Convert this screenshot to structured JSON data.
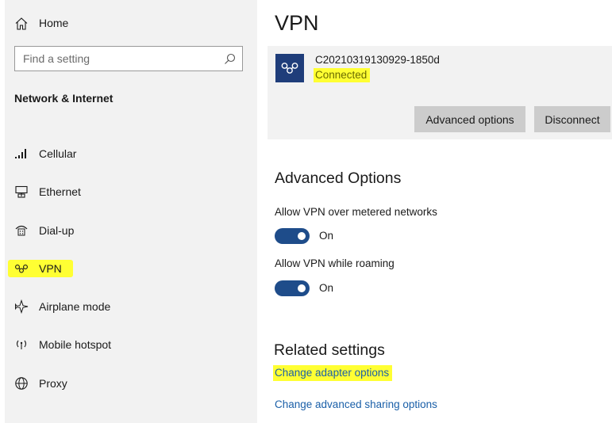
{
  "sidebar": {
    "home_label": "Home",
    "search_placeholder": "Find a setting",
    "section_title": "Network & Internet",
    "items": [
      {
        "label": "Cellular",
        "icon": "cellular-signal-icon"
      },
      {
        "label": "Ethernet",
        "icon": "ethernet-icon"
      },
      {
        "label": "Dial-up",
        "icon": "dialup-icon"
      },
      {
        "label": "VPN",
        "icon": "vpn-icon",
        "selected": true
      },
      {
        "label": "Airplane mode",
        "icon": "airplane-icon"
      },
      {
        "label": "Mobile hotspot",
        "icon": "hotspot-icon"
      },
      {
        "label": "Proxy",
        "icon": "globe-icon"
      }
    ]
  },
  "main": {
    "title": "VPN",
    "connection": {
      "name": "C20210319130929-1850d",
      "status": "Connected",
      "advanced_button": "Advanced options",
      "disconnect_button": "Disconnect"
    },
    "advanced": {
      "heading": "Advanced Options",
      "metered_label": "Allow VPN over metered networks",
      "metered_state": "On",
      "roaming_label": "Allow VPN while roaming",
      "roaming_state": "On"
    },
    "related": {
      "heading": "Related settings",
      "link_adapter": "Change adapter options",
      "link_sharing": "Change advanced sharing options"
    }
  },
  "colors": {
    "accent": "#1e4c8a",
    "link": "#1a5fa8",
    "highlight": "#ffff33",
    "sidebar_bg": "#f2f2f2"
  }
}
